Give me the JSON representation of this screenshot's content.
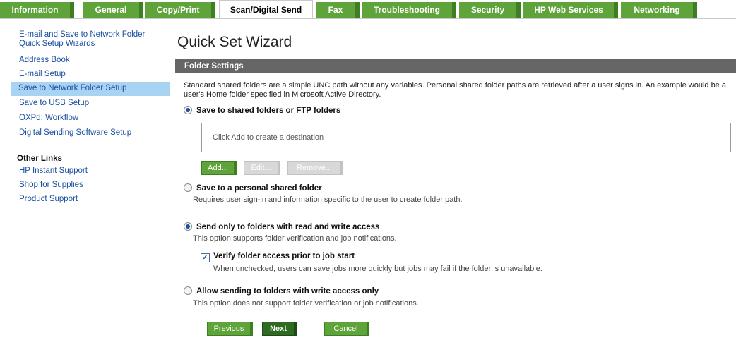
{
  "tabs": [
    {
      "label": "Information",
      "active": false
    },
    {
      "label": "General",
      "active": false
    },
    {
      "label": "Copy/Print",
      "active": false
    },
    {
      "label": "Scan/Digital Send",
      "active": true
    },
    {
      "label": "Fax",
      "active": false
    },
    {
      "label": "Troubleshooting",
      "active": false
    },
    {
      "label": "Security",
      "active": false
    },
    {
      "label": "HP Web Services",
      "active": false
    },
    {
      "label": "Networking",
      "active": false
    }
  ],
  "sidebar": {
    "links": [
      {
        "label": "E-mail and Save to Network Folder",
        "label2": "Quick Setup Wizards"
      },
      {
        "label": "Address Book"
      },
      {
        "label": "E-mail Setup"
      },
      {
        "label": "Save to Network Folder Setup",
        "selected": true
      },
      {
        "label": "Save to USB Setup"
      },
      {
        "label": "OXPd: Workflow"
      },
      {
        "label": "Digital Sending Software Setup"
      }
    ],
    "other_heading": "Other Links",
    "other_links": [
      {
        "label": "HP Instant Support"
      },
      {
        "label": "Shop for Supplies"
      },
      {
        "label": "Product Support"
      }
    ]
  },
  "main": {
    "title": "Quick Set Wizard",
    "section_title": "Folder Settings",
    "description": "Standard shared folders are a simple UNC path without any variables. Personal shared folder paths are retrieved after a user signs in. An example would be a user's Home folder specified in Microsoft Active Directory.",
    "options": {
      "shared": {
        "label": "Save to shared folders or FTP folders",
        "selected": true
      },
      "destination_placeholder": "Click Add to create a destination",
      "add_button": "Add...",
      "edit_button": "Edit...",
      "remove_button": "Remove...",
      "personal": {
        "label": "Save to a personal shared folder",
        "sub": "Requires user sign-in and information specific to the user to create folder path.",
        "selected": false
      },
      "readwrite": {
        "label": "Send only to folders with read and write access",
        "sub": "This option supports folder verification and job notifications.",
        "selected": true
      },
      "verify": {
        "label": "Verify folder access prior to job start",
        "sub": "When unchecked, users can save jobs more quickly but jobs may fail if the folder is unavailable.",
        "checked": true
      },
      "writeonly": {
        "label": "Allow sending to folders with write access only",
        "sub": "This option does not support folder verification or job notifications.",
        "selected": false
      }
    },
    "footer": {
      "previous_button": "Previous",
      "next_button": "Next",
      "cancel_button": "Cancel"
    }
  },
  "colors": {
    "tab_green": "#5fa43a",
    "section_bar": "#666666",
    "selected_link_bg": "#a9d3f3",
    "link_blue": "#1a4fa0"
  }
}
